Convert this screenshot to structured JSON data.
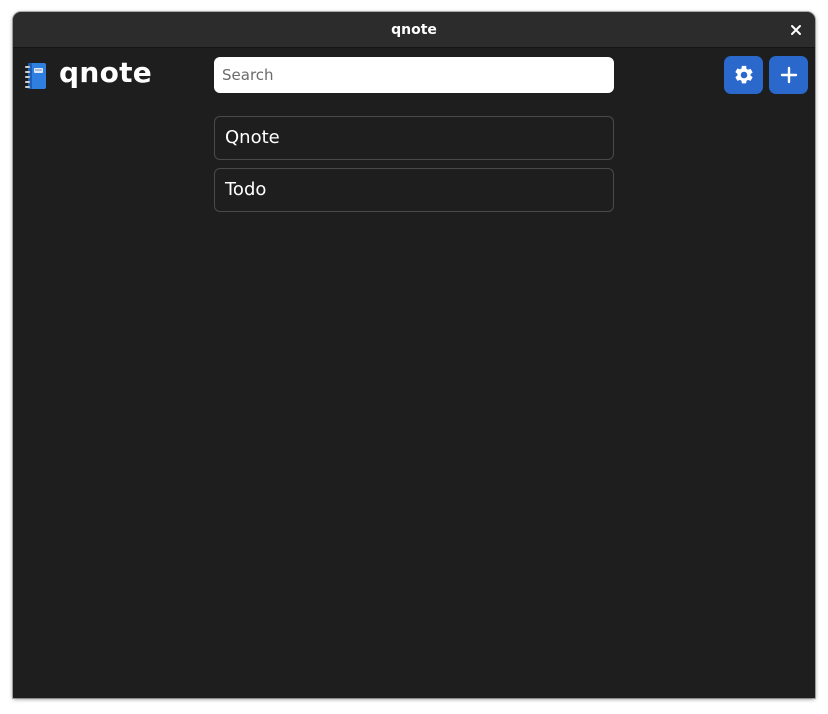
{
  "window": {
    "title": "qnote"
  },
  "app": {
    "name": "qnote",
    "logo_icon": "notebook-icon"
  },
  "search": {
    "placeholder": "Search",
    "value": ""
  },
  "toolbar": {
    "settings_icon": "gear-icon",
    "add_icon": "plus-icon"
  },
  "notes": [
    {
      "title": "Qnote"
    },
    {
      "title": "Todo"
    }
  ],
  "colors": {
    "background": "#1e1e1e",
    "titlebar": "#2c2c2c",
    "accent": "#2a68cc",
    "text": "#ffffff",
    "border": "#4a4a4a"
  }
}
